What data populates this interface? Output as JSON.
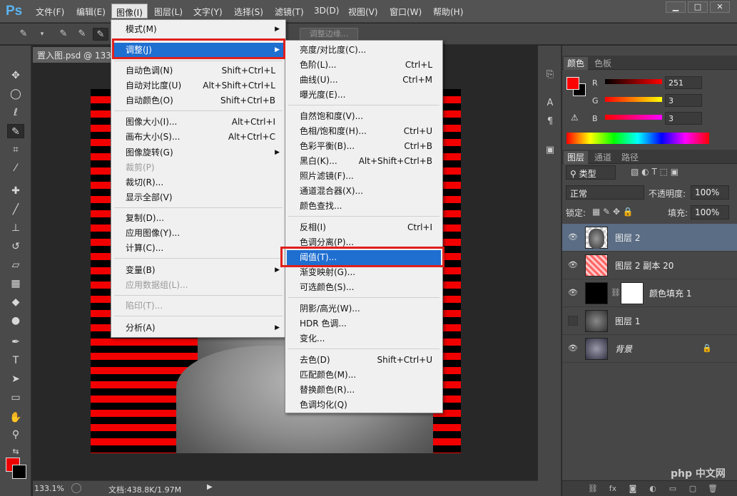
{
  "app": {
    "logo": "Ps"
  },
  "menubar": [
    {
      "label": "文件(F)"
    },
    {
      "label": "编辑(E)"
    },
    {
      "label": "图像(I)"
    },
    {
      "label": "图层(L)"
    },
    {
      "label": "文字(Y)"
    },
    {
      "label": "选择(S)"
    },
    {
      "label": "滤镜(T)"
    },
    {
      "label": "3D(D)"
    },
    {
      "label": "视图(V)"
    },
    {
      "label": "窗口(W)"
    },
    {
      "label": "帮助(H)"
    }
  ],
  "window_buttons": {
    "minimize": "▁",
    "restore": "□",
    "close": "✕"
  },
  "options_bar": {
    "refine_edge": "调整边缘..."
  },
  "document_tab": {
    "title": "置入图.psd @ 133"
  },
  "status_bar": {
    "zoom": "133.1%",
    "doc_info": "文档:438.8K/1.97M"
  },
  "image_menu": [
    {
      "label": "模式(M)",
      "submenu": true
    },
    {
      "label": "调整(J)",
      "submenu": true,
      "highlight": true
    },
    {
      "label": "自动色调(N)",
      "shortcut": "Shift+Ctrl+L"
    },
    {
      "label": "自动对比度(U)",
      "shortcut": "Alt+Shift+Ctrl+L"
    },
    {
      "label": "自动颜色(O)",
      "shortcut": "Shift+Ctrl+B"
    },
    {
      "label": "图像大小(I)...",
      "shortcut": "Alt+Ctrl+I"
    },
    {
      "label": "画布大小(S)...",
      "shortcut": "Alt+Ctrl+C"
    },
    {
      "label": "图像旋转(G)",
      "submenu": true
    },
    {
      "label": "裁剪(P)",
      "disabled": true
    },
    {
      "label": "裁切(R)..."
    },
    {
      "label": "显示全部(V)"
    },
    {
      "label": "复制(D)..."
    },
    {
      "label": "应用图像(Y)..."
    },
    {
      "label": "计算(C)..."
    },
    {
      "label": "变量(B)",
      "submenu": true
    },
    {
      "label": "应用数据组(L)...",
      "disabled": true
    },
    {
      "label": "陷印(T)...",
      "disabled": true
    },
    {
      "label": "分析(A)",
      "submenu": true
    }
  ],
  "adjust_menu": [
    {
      "label": "亮度/对比度(C)..."
    },
    {
      "label": "色阶(L)...",
      "shortcut": "Ctrl+L"
    },
    {
      "label": "曲线(U)...",
      "shortcut": "Ctrl+M"
    },
    {
      "label": "曝光度(E)..."
    },
    {
      "label": "自然饱和度(V)..."
    },
    {
      "label": "色相/饱和度(H)...",
      "shortcut": "Ctrl+U"
    },
    {
      "label": "色彩平衡(B)...",
      "shortcut": "Ctrl+B"
    },
    {
      "label": "黑白(K)...",
      "shortcut": "Alt+Shift+Ctrl+B"
    },
    {
      "label": "照片滤镜(F)..."
    },
    {
      "label": "通道混合器(X)..."
    },
    {
      "label": "颜色查找..."
    },
    {
      "label": "反相(I)",
      "shortcut": "Ctrl+I"
    },
    {
      "label": "色调分离(P)..."
    },
    {
      "label": "阈值(T)...",
      "highlight": true
    },
    {
      "label": "渐变映射(G)..."
    },
    {
      "label": "可选颜色(S)..."
    },
    {
      "label": "阴影/高光(W)..."
    },
    {
      "label": "HDR 色调..."
    },
    {
      "label": "变化..."
    },
    {
      "label": "去色(D)",
      "shortcut": "Shift+Ctrl+U"
    },
    {
      "label": "匹配颜色(M)..."
    },
    {
      "label": "替换颜色(R)..."
    },
    {
      "label": "色调均化(Q)"
    }
  ],
  "color_panel": {
    "tabs": [
      "颜色",
      "色板"
    ],
    "r_label": "R",
    "g_label": "G",
    "b_label": "B",
    "r": "251",
    "g": "3",
    "b": "3",
    "foreground": "#fb0303"
  },
  "layers_panel": {
    "tabs": [
      "图层",
      "通道",
      "路径"
    ],
    "filter_kind": "类型",
    "blend_mode": "正常",
    "opacity_label": "不透明度:",
    "opacity": "100%",
    "lock_label": "锁定:",
    "fill_label": "填充:",
    "fill": "100%",
    "layers": [
      {
        "name": "图层 2",
        "visible": true,
        "selected": true
      },
      {
        "name": "图层 2 副本 20",
        "visible": true
      },
      {
        "name": "颜色填充 1",
        "visible": true
      },
      {
        "name": "图层 1",
        "visible": false
      },
      {
        "name": "背景",
        "visible": true,
        "locked": true
      }
    ]
  },
  "watermark": {
    "text": "php 中文网"
  }
}
